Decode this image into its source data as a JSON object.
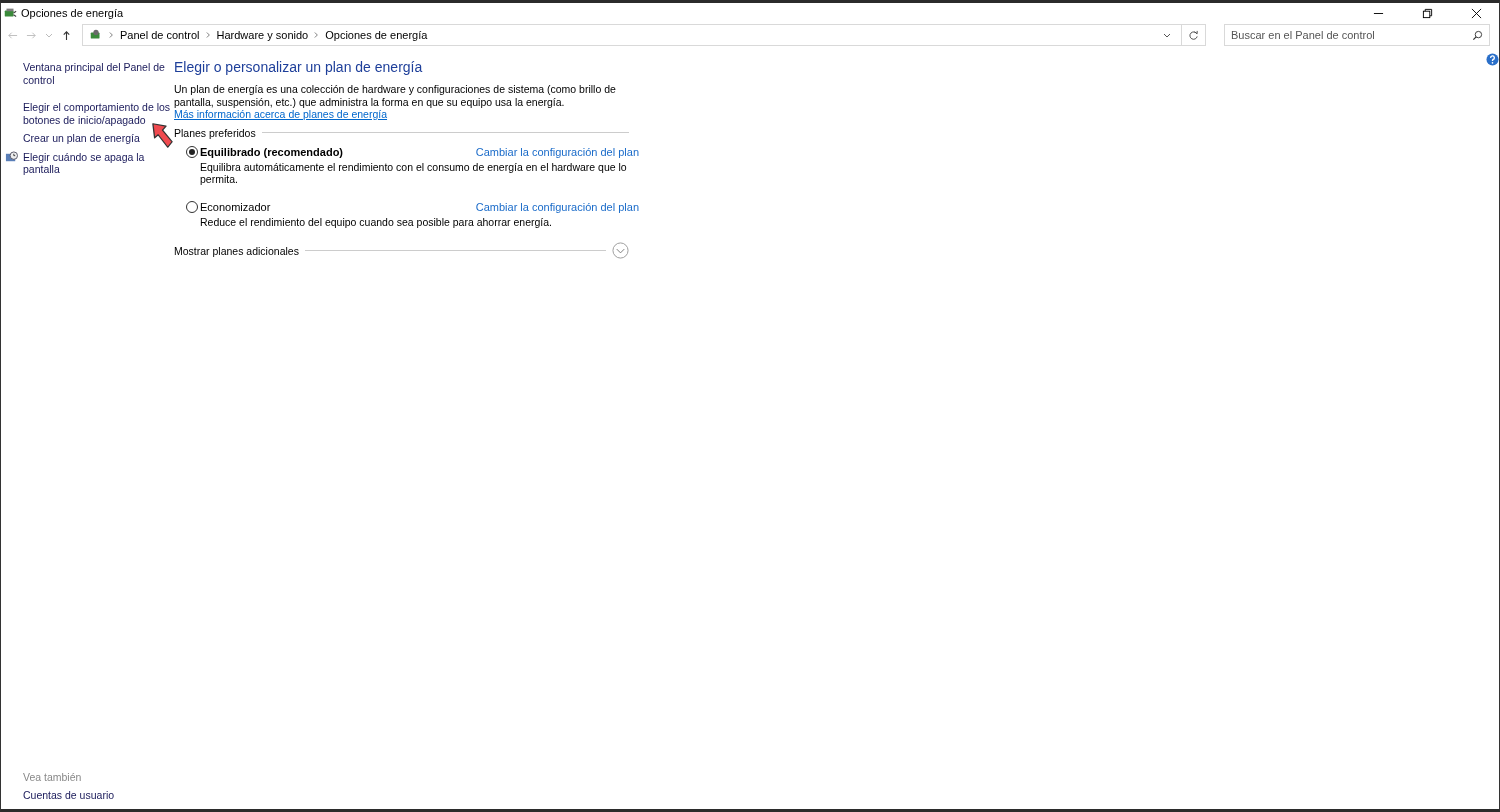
{
  "window": {
    "title": "Opciones de energía"
  },
  "breadcrumb": [
    "Panel de control",
    "Hardware y sonido",
    "Opciones de energía"
  ],
  "search": {
    "placeholder": "Buscar en el Panel de control"
  },
  "sidebar": {
    "items": [
      {
        "label": "Ventana principal del Panel de control",
        "kind": "link"
      },
      {
        "label": "Elegir el comportamiento de los botones de inicio/apagado",
        "kind": "link"
      },
      {
        "label": "Crear un plan de energía",
        "kind": "link"
      },
      {
        "label": "Elegir cuándo se apaga la pantalla",
        "kind": "icon-link"
      }
    ],
    "see_also": {
      "heading": "Vea también",
      "links": [
        "Cuentas de usuario"
      ]
    }
  },
  "main": {
    "heading": "Elegir o personalizar un plan de energía",
    "intro": "Un plan de energía es una colección de hardware y configuraciones de sistema (como brillo de pantalla, suspensión, etc.) que administra la forma en que su equipo usa la energía. ",
    "intro_link": "Más información acerca de planes de energía",
    "group_label": "Planes preferidos",
    "plans": [
      {
        "name": "Equilibrado (recomendado)",
        "selected": true,
        "link": "Cambiar la configuración del plan",
        "description": "Equilibra automáticamente el rendimiento con el consumo de energía en el hardware que lo permita."
      },
      {
        "name": "Economizador",
        "selected": false,
        "link": "Cambiar la configuración del plan",
        "description": "Reduce el rendimiento del equipo cuando sea posible para ahorrar energía."
      }
    ],
    "more_plans": {
      "label": "Mostrar planes adicionales",
      "expanded": false
    }
  }
}
